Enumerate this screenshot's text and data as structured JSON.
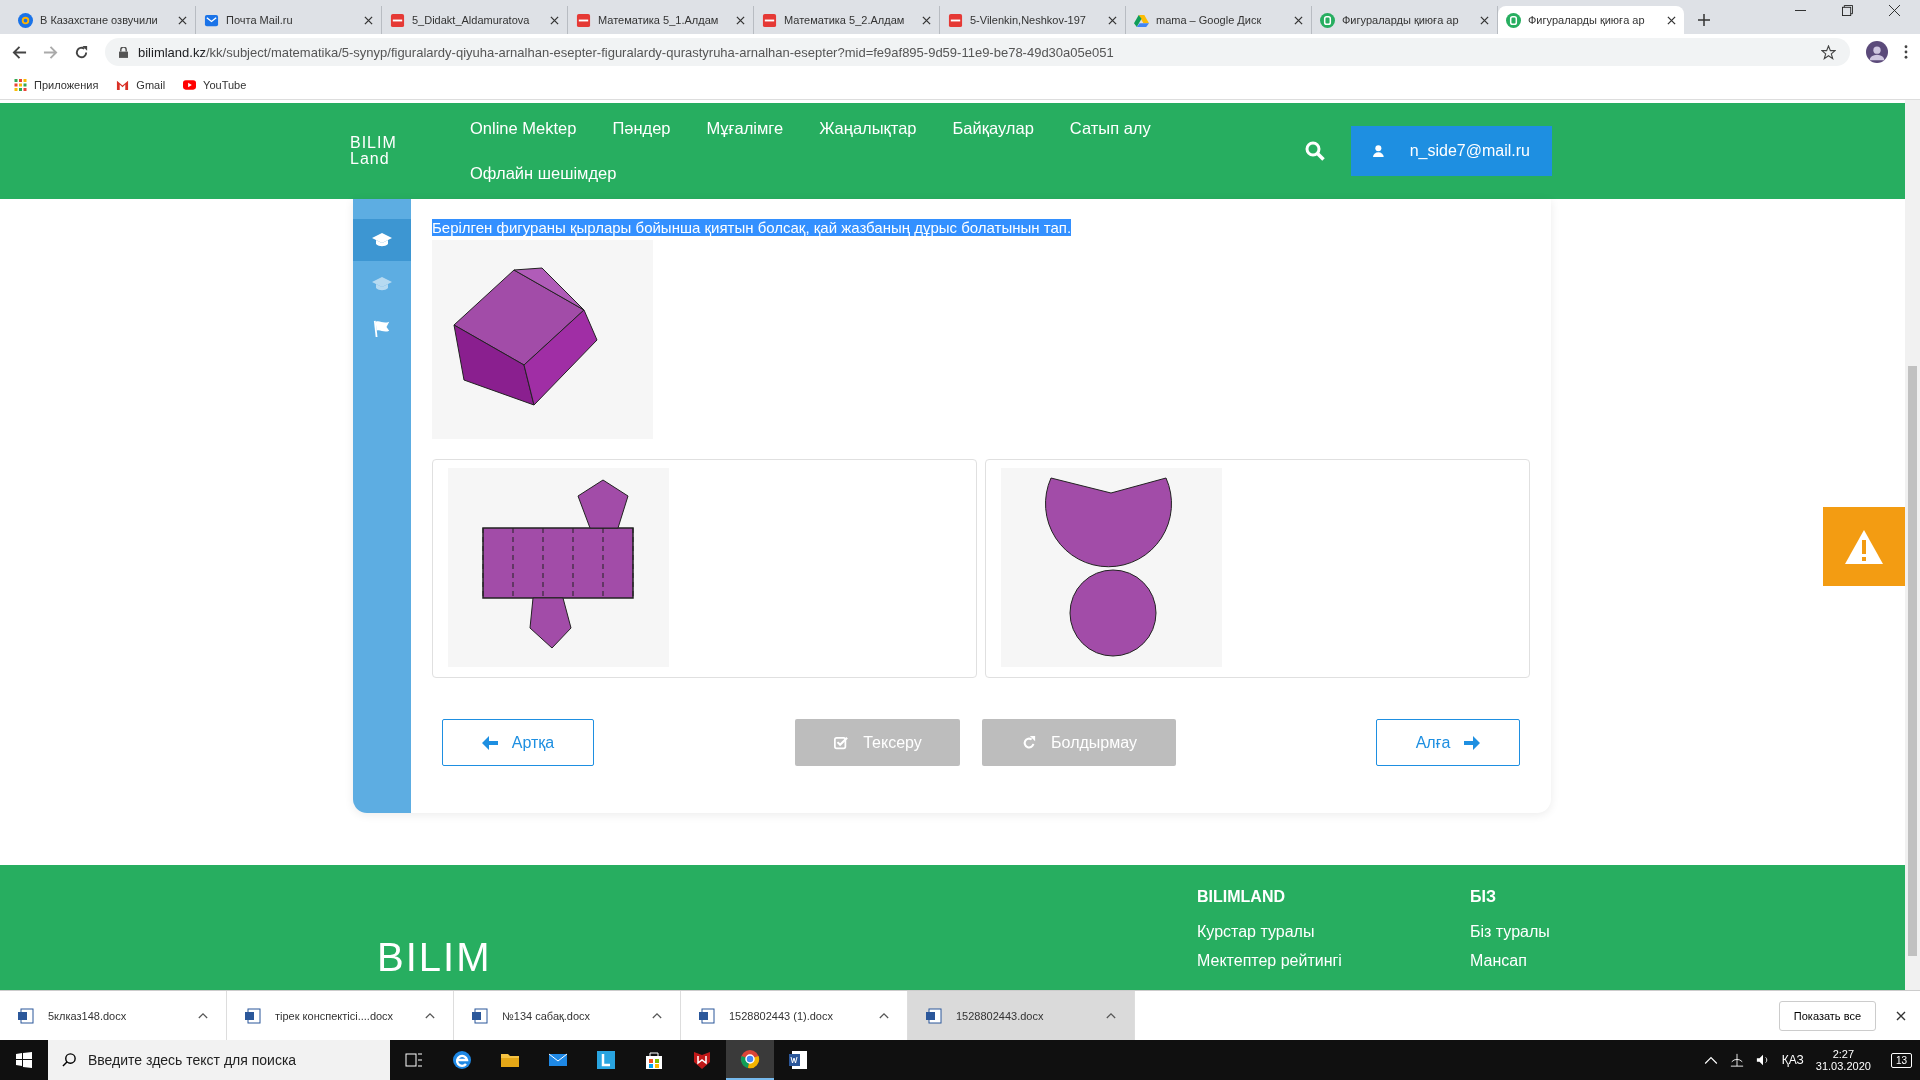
{
  "browser": {
    "tabs": [
      {
        "title": "В Казахстане озвучили",
        "kind": "at",
        "selected": false
      },
      {
        "title": "Почта Mail.ru",
        "kind": "mail",
        "selected": false
      },
      {
        "title": "5_Didakt_Aldamuratova",
        "kind": "pdf",
        "selected": false
      },
      {
        "title": "Математика 5_1.Алдам",
        "kind": "pdf",
        "selected": false
      },
      {
        "title": "Математика 5_2.Алдам",
        "kind": "pdf",
        "selected": false
      },
      {
        "title": "5-Vilenkin,Neshkov-197",
        "kind": "pdf",
        "selected": false
      },
      {
        "title": "mama – Google Диск",
        "kind": "drive",
        "selected": false
      },
      {
        "title": "Фигураларды қиюға ар",
        "kind": "bilim",
        "selected": false
      },
      {
        "title": "Фигураларды қиюға ар",
        "kind": "bilim",
        "selected": true
      }
    ],
    "url_host": "bilimland.kz",
    "url_path": "/kk/subject/matematika/5-synyp/figuralardy-qiyuha-arnalhan-esepter-figuralardy-qurastyruha-arnalhan-esepter?mid=fe9af895-9d59-11e9-be78-49d30a05e051",
    "bookmarks": [
      {
        "label": "Приложения",
        "kind": "apps"
      },
      {
        "label": "Gmail",
        "kind": "gmail"
      },
      {
        "label": "YouTube",
        "kind": "youtube"
      }
    ]
  },
  "header": {
    "logo": [
      "BILIM",
      "Land"
    ],
    "nav": [
      "Online Mektep",
      "Пәндер",
      "Мұғалімге",
      "Жаңалықтар",
      "Байқаулар",
      "Сатып алу",
      "Офлайн шешімдер"
    ],
    "user": "n_side7@mail.ru"
  },
  "sidebar": [
    {
      "kind": "cap",
      "selected": true
    },
    {
      "kind": "cap",
      "selected": false
    },
    {
      "kind": "flag",
      "selected": false
    }
  ],
  "question": "Берілген фигураны қырлары бойынша қиятын болсақ, қай жазбаның дұрыс болатынын тап.",
  "buttons": [
    {
      "label": "Артқа",
      "kind": "back",
      "disabled": false
    },
    {
      "label": "Тексеру",
      "kind": "check",
      "disabled": true
    },
    {
      "label": "Болдырмау",
      "kind": "reset",
      "disabled": true
    },
    {
      "label": "Алға",
      "kind": "next",
      "disabled": false
    }
  ],
  "footer": {
    "logo": [
      "BILIM"
    ],
    "columns": [
      {
        "heading": "BILIMLAND",
        "links": [
          "Курстар туралы",
          "Мектептер рейтингі"
        ]
      },
      {
        "heading": "БІЗ",
        "links": [
          "Біз туралы",
          "Мансап"
        ]
      }
    ]
  },
  "downloads": {
    "files": [
      {
        "name": "5клказ148.docx",
        "selected": false
      },
      {
        "name": "тірек конспектісі....docx",
        "selected": false
      },
      {
        "name": "№134 сабақ.docx",
        "selected": false
      },
      {
        "name": "1528802443 (1).docx",
        "selected": false
      },
      {
        "name": "1528802443.docx",
        "selected": true
      }
    ],
    "show_all": "Показать все"
  },
  "taskbar": {
    "search_placeholder": "Введите здесь текст для поиска",
    "language": "ҚАЗ",
    "time": "2:27",
    "date": "31.03.2020",
    "notifications": "13"
  }
}
